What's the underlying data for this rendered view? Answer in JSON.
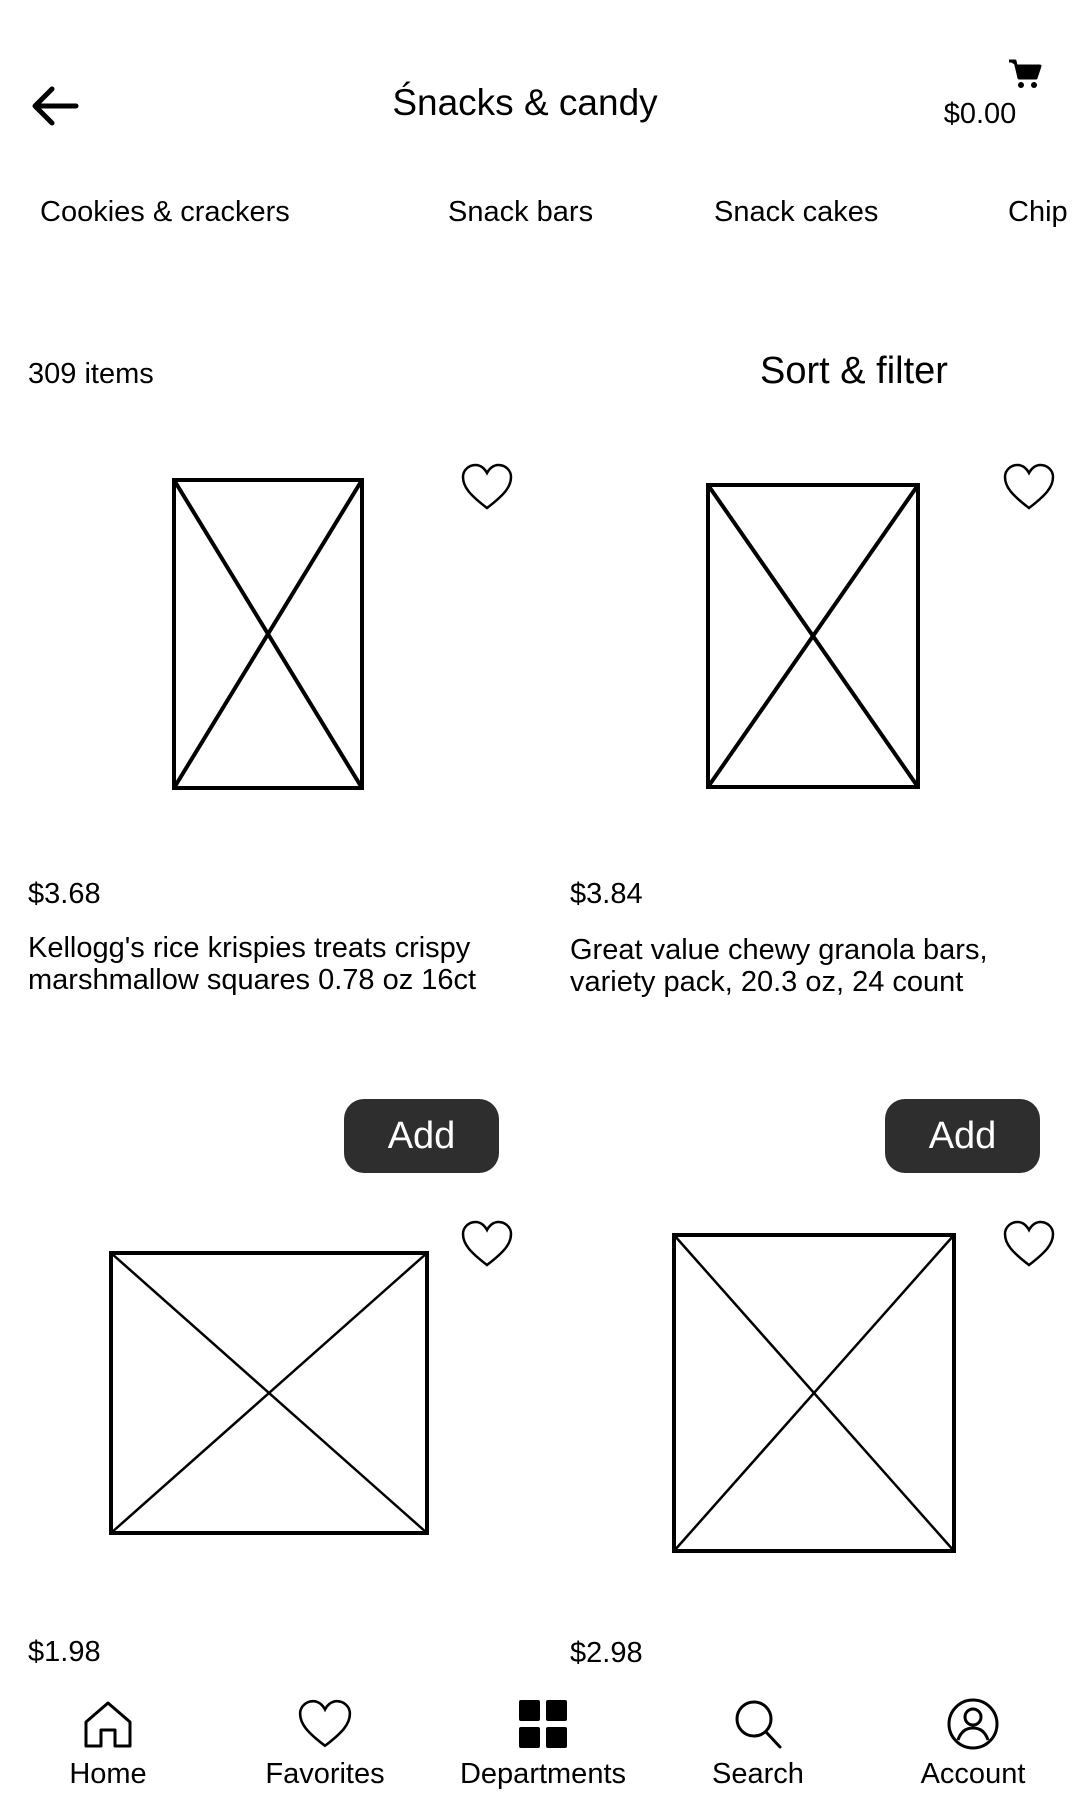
{
  "header": {
    "back_icon": "arrow-left-icon",
    "title": "Śnacks & candy",
    "cart_icon": "cart-icon",
    "cart_total": "$0.00"
  },
  "categories": [
    {
      "label": "Cookies & crackers"
    },
    {
      "label": "Snack bars"
    },
    {
      "label": "Snack cakes"
    },
    {
      "label": "Chip"
    }
  ],
  "results": {
    "count": "309 items",
    "sort_label": "Sort & filter"
  },
  "products": [
    {
      "price": "$3.68",
      "name": "Kellogg's rice krispies treats crispy marshmallow squares 0.78 oz 16ct",
      "add_label": "Add"
    },
    {
      "price": "$3.84",
      "name": "Great value chewy granola bars, variety pack, 20.3 oz, 24 count",
      "add_label": "Add"
    },
    {
      "price": "$1.98",
      "name": ""
    },
    {
      "price": "$2.98",
      "name": ""
    }
  ],
  "nav": [
    {
      "label": "Home",
      "icon": "home-icon"
    },
    {
      "label": "Favorites",
      "icon": "heart-icon"
    },
    {
      "label": "Departments",
      "icon": "grid-icon"
    },
    {
      "label": "Search",
      "icon": "search-icon"
    },
    {
      "label": "Account",
      "icon": "account-icon"
    }
  ]
}
